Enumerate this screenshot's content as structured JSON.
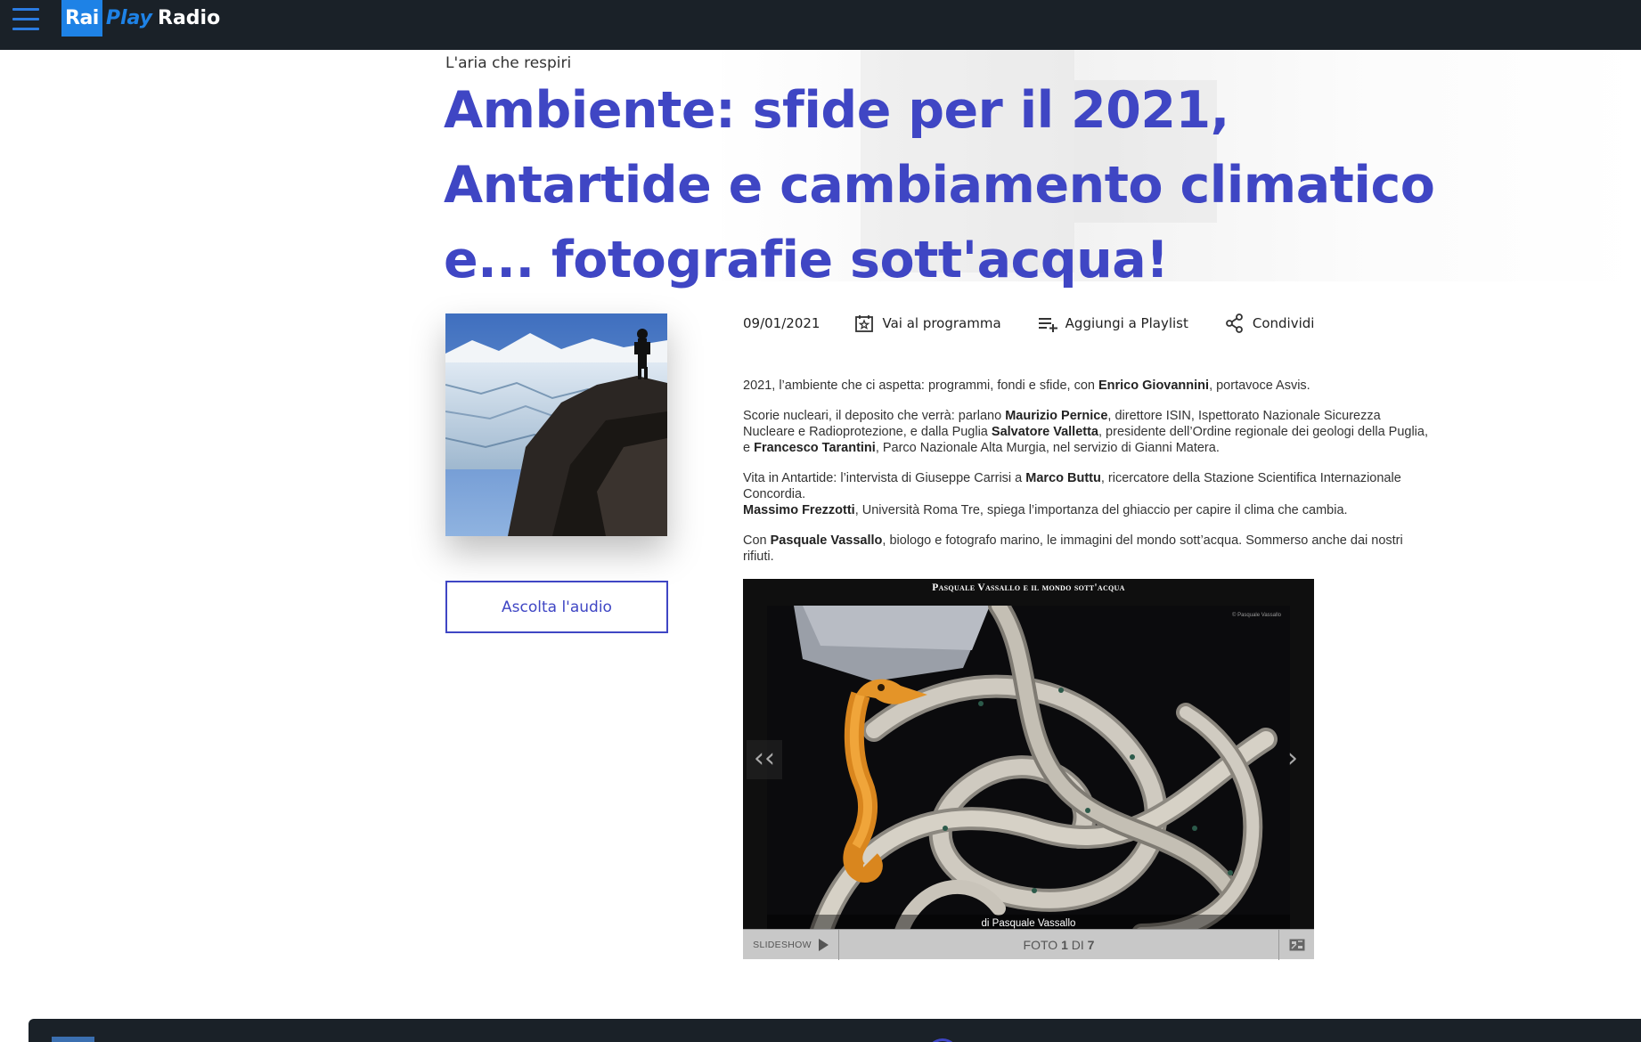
{
  "header": {
    "logo_rai": "Rai",
    "logo_play": "Play",
    "logo_radio": "Radio"
  },
  "program": {
    "name": "L'aria che respiri"
  },
  "title": "Ambiente: sfide per il 2021, Antartide e cambiamento climatico e... fotografie sott'acqua!",
  "actions": {
    "date": "09/01/2021",
    "program_link": "Vai al programma",
    "playlist": "Aggiungi a Playlist",
    "share": "Condividi"
  },
  "listen_button": "Ascolta l'audio",
  "description": {
    "p1": {
      "a": "2021, l’ambiente che ci aspetta: programmi, fondi e sfide, con ",
      "b": "Enrico Giovannini",
      "c": ", portavoce Asvis."
    },
    "p2": {
      "a": "Scorie nucleari, il deposito che verrà: parlano ",
      "b": "Maurizio Pernice",
      "c": ", direttore ISIN, Ispettorato Nazionale Sicurezza Nucleare e Radioprotezione, e dalla Puglia ",
      "d": "Salvatore Valletta",
      "e": ", presidente dell’Ordine regionale dei geologi della Puglia, e ",
      "f": "Francesco Tarantini",
      "g": ", Parco Nazionale Alta Murgia, nel servizio di Gianni Matera."
    },
    "p3": {
      "a": "Vita in Antartide: l’intervista di Giuseppe Carrisi a ",
      "b": "Marco Buttu",
      "c": ", ricercatore della Stazione Scientifica Internazionale Concordia.",
      "d": "Massimo Frezzotti",
      "e": ", Università Roma Tre, spiega l’importanza del ghiaccio per capire il clima che cambia."
    },
    "p4": {
      "a": "Con ",
      "b": "Pasquale Vassallo",
      "c": ", biologo e fotografo marino, le immagini del mondo sott’acqua. Sommerso anche dai nostri rifiuti."
    }
  },
  "gallery": {
    "title": "Pasquale Vassallo e il mondo sott'acqua",
    "watermark": "© Pasquale Vassallo",
    "caption": "di Pasquale Vassallo",
    "prev": "‹‹",
    "next": "›",
    "slideshow_label": "SLIDESHOW",
    "counter_prefix": "FOTO ",
    "counter_current": "1",
    "counter_mid": " DI ",
    "counter_total": "7"
  },
  "colors": {
    "brand": "#3f46c4",
    "topbar": "#1a2128",
    "rai_blue": "#1e82e6"
  },
  "icons": [
    "hamburger-menu-icon",
    "star-calendar-icon",
    "playlist-add-icon",
    "share-icon",
    "play-icon",
    "fullscreen-icon"
  ]
}
